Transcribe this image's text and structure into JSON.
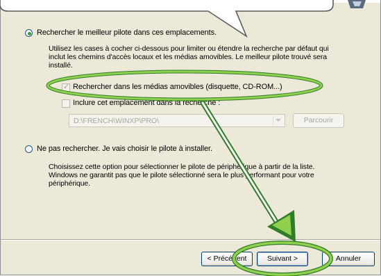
{
  "wizard": {
    "option_search": {
      "label": "Rechercher le meilleur pilote dans ces emplacements.",
      "description_line1": "Utilisez les cases à cocher ci-dessous pour limiter ou étendre la recherche par défaut qui",
      "description_line2": "inclut les chemins d'accès locaux et les médias amovibles. Le meilleur pilote trouvé sera",
      "description_line3": "installé.",
      "checkbox_removable": {
        "label": "Rechercher dans les médias amovibles (disquette, CD-ROM...)",
        "checked": true
      },
      "checkbox_location": {
        "label": "Inclure cet emplacement dans la recherche :",
        "checked": false
      },
      "path_value": "D:\\FRENCH\\WINXP\\PRO\\",
      "browse_label": "Parcourir"
    },
    "option_manual": {
      "label": "Ne pas rechercher. Je vais choisir le pilote à installer.",
      "description_line1": "Choisissez cette option pour sélectionner le pilote de périphérique à partir de la liste.",
      "description_line2": "Windows ne garantit pas que le pilote sélectionné sera le plus performant pour votre",
      "description_line3": "périphérique."
    },
    "buttons": {
      "back": "< Précédent",
      "next": "Suivant >",
      "cancel": "Annuler"
    }
  },
  "colors": {
    "dialog_bg": "#ece9d8",
    "highlight_green": "#7dc142",
    "highlight_green_dark": "#2f7d27",
    "disabled_text": "#a7a698"
  },
  "icons": {
    "radio_selected": "radio-selected-icon",
    "radio_unselected": "radio-unselected-icon",
    "checkmark": "check-icon",
    "dropdown": "chevron-down-icon",
    "pointer_arrow": "arrow-pointer-icon"
  }
}
